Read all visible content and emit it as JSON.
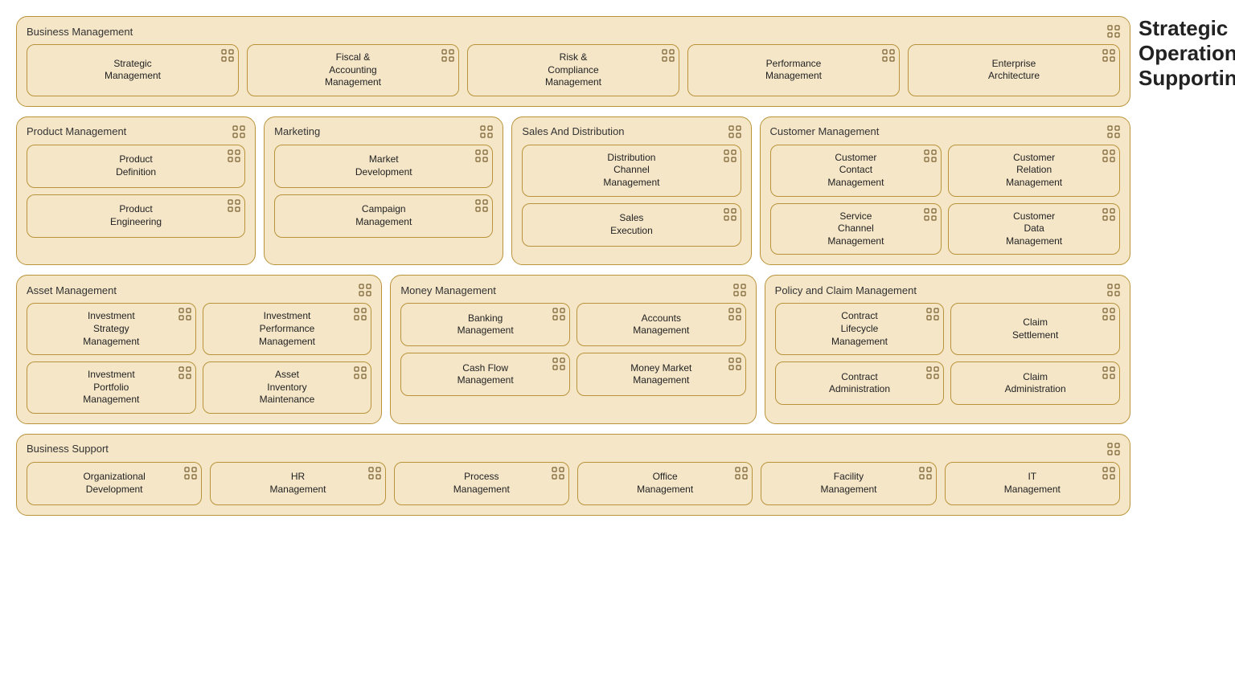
{
  "strategic_label": "Strategic",
  "operational_label": "Operational",
  "supporting_label": "Supporting",
  "biz_management": {
    "title": "Business Management",
    "items": [
      {
        "label": "Strategic\nManagement"
      },
      {
        "label": "Fiscal &\nAccounting\nManagement"
      },
      {
        "label": "Risk &\nCompliance\nManagement"
      },
      {
        "label": "Performance\nManagement"
      },
      {
        "label": "Enterprise\nArchitecture"
      }
    ]
  },
  "product_management": {
    "title": "Product Management",
    "items": [
      {
        "label": "Product\nDefinition"
      },
      {
        "label": "Product\nEngineering"
      }
    ]
  },
  "marketing": {
    "title": "Marketing",
    "items": [
      {
        "label": "Market\nDevelopment"
      },
      {
        "label": "Campaign\nManagement"
      }
    ]
  },
  "sales_distribution": {
    "title": "Sales And Distribution",
    "items": [
      {
        "label": "Distribution\nChannel\nManagement"
      },
      {
        "label": "Sales\nExecution"
      }
    ]
  },
  "customer_management": {
    "title": "Customer Management",
    "items": [
      {
        "label": "Customer\nContact\nManagement"
      },
      {
        "label": "Customer\nRelation\nManagement"
      },
      {
        "label": "Service\nChannel\nManagement"
      },
      {
        "label": "Customer\nData\nManagement"
      }
    ]
  },
  "asset_management": {
    "title": "Asset Management",
    "items": [
      {
        "label": "Investment\nStrategy\nManagement"
      },
      {
        "label": "Investment\nPerformance\nManagement"
      },
      {
        "label": "Investment\nPortfolio\nManagement"
      },
      {
        "label": "Asset\nInventory\nMaintenance"
      }
    ]
  },
  "money_management": {
    "title": "Money Management",
    "items": [
      {
        "label": "Banking\nManagement"
      },
      {
        "label": "Accounts\nManagement"
      },
      {
        "label": "Cash Flow\nManagement"
      },
      {
        "label": "Money Market\nManagement"
      }
    ]
  },
  "policy_claim": {
    "title": "Policy and Claim Management",
    "items": [
      {
        "label": "Contract\nLifecycle\nManagement"
      },
      {
        "label": "Claim\nSettlement"
      },
      {
        "label": "Contract\nAdministration"
      },
      {
        "label": "Claim\nAdministration"
      }
    ]
  },
  "business_support": {
    "title": "Business Support",
    "items": [
      {
        "label": "Organizational\nDevelopment"
      },
      {
        "label": "HR\nManagement"
      },
      {
        "label": "Process\nManagement"
      },
      {
        "label": "Office\nManagement"
      },
      {
        "label": "Facility\nManagement"
      },
      {
        "label": "IT\nManagement"
      }
    ]
  }
}
